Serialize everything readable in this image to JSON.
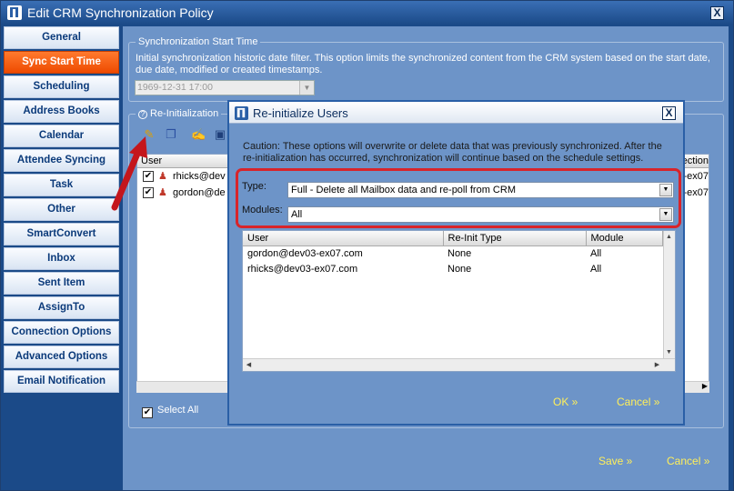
{
  "window": {
    "title": "Edit CRM Synchronization Policy",
    "close_glyph": "X"
  },
  "sidebar": {
    "items": [
      {
        "label": "General"
      },
      {
        "label": "Sync Start Time"
      },
      {
        "label": "Scheduling"
      },
      {
        "label": "Address Books"
      },
      {
        "label": "Calendar"
      },
      {
        "label": "Attendee Syncing"
      },
      {
        "label": "Task"
      },
      {
        "label": "Other"
      },
      {
        "label": "SmartConvert"
      },
      {
        "label": "Inbox"
      },
      {
        "label": "Sent Item"
      },
      {
        "label": "AssignTo"
      },
      {
        "label": "Connection Options"
      },
      {
        "label": "Advanced Options"
      },
      {
        "label": "Email Notification"
      }
    ],
    "active_index": 1
  },
  "sync_start": {
    "legend": "Synchronization Start Time",
    "help": "Initial synchronization historic date filter.  This option limits the synchronized content from the CRM system based on the start date, due date, modified or created timestamps.",
    "date_value": "1969-12-31 17:00"
  },
  "reinit": {
    "legend": "Re-Initialization",
    "grid_header_user": "User",
    "grid_header_right": "ection",
    "rows": [
      {
        "user": "rhicks@dev",
        "right": "3-ex07"
      },
      {
        "user": "gordon@de",
        "right": "3-ex07"
      }
    ],
    "select_all_label": "Select All"
  },
  "footer": {
    "save_label": "Save »",
    "cancel_label": "Cancel »"
  },
  "dialog": {
    "title": "Re-initialize Users",
    "close_glyph": "X",
    "caution": "Caution: These options will overwrite or delete data that was previously synchronized.  After the re-initialization has occurred, synchronization will continue based on the schedule settings.",
    "type_label": "Type:",
    "type_value": "Full - Delete all Mailbox data and re-poll from CRM",
    "modules_label": "Modules:",
    "modules_value": "All",
    "columns": [
      "User",
      "Re-Init Type",
      "Module"
    ],
    "rows": [
      [
        "gordon@dev03-ex07.com",
        "None",
        "All"
      ],
      [
        "rhicks@dev03-ex07.com",
        "None",
        "All"
      ]
    ],
    "ok_label": "OK »",
    "cancel_label": "Cancel »"
  },
  "colors": {
    "panel_bg": "#6d94c8",
    "active_tab": "#ee4a00",
    "link_yellow": "#ffef5a",
    "highlight_red": "#d8242a"
  }
}
